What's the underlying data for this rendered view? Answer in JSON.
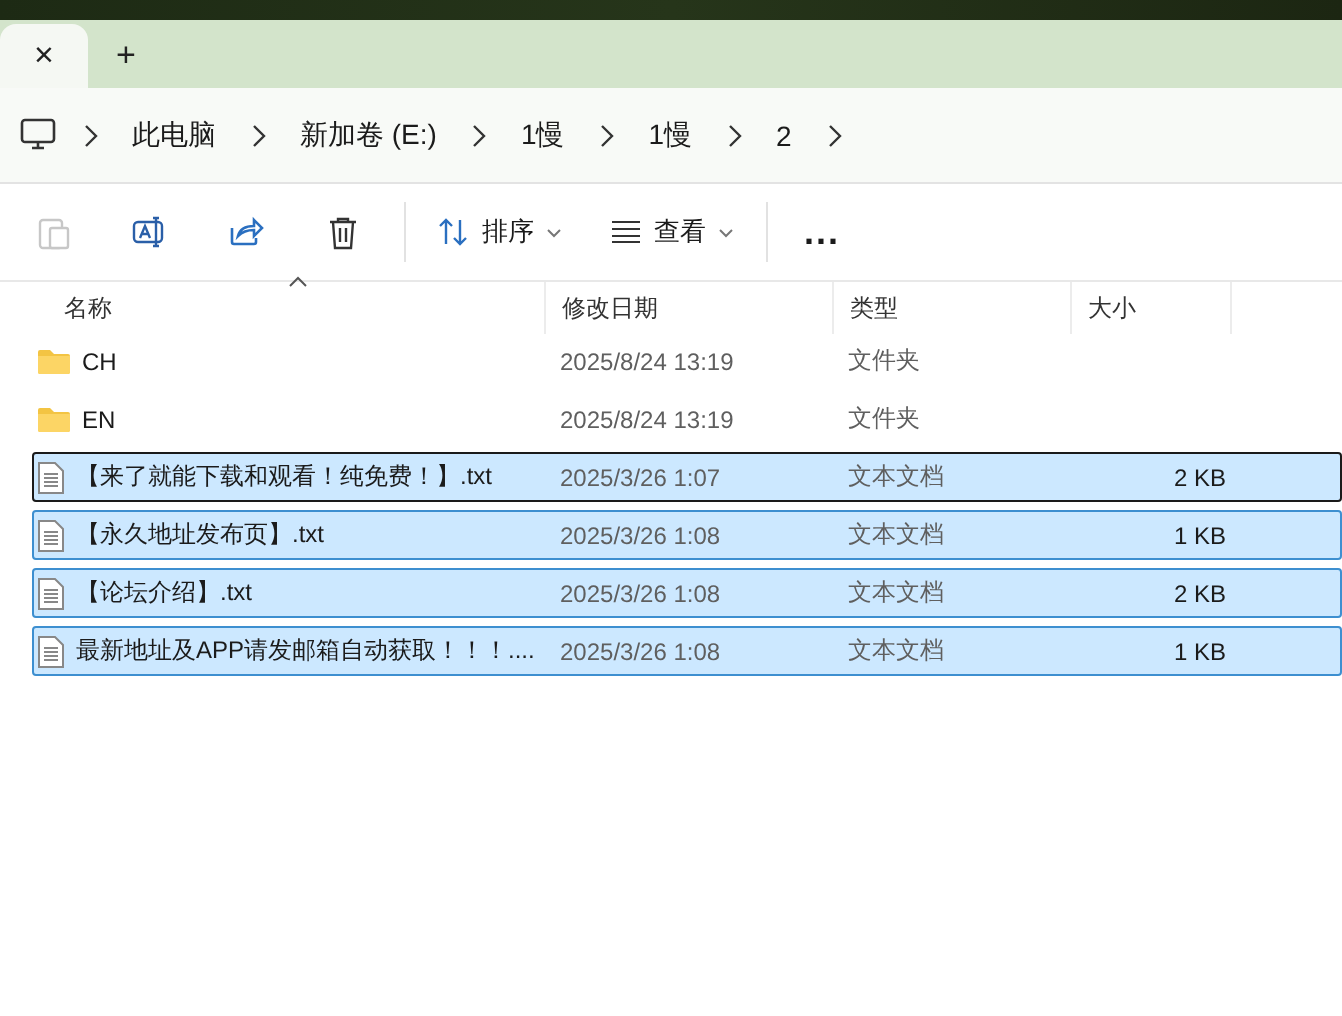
{
  "tab": {
    "close": "×",
    "add": "+"
  },
  "breadcrumb": [
    "此电脑",
    "新加卷 (E:)",
    "1慢",
    "1慢",
    "2"
  ],
  "toolbar": {
    "sort": "排序",
    "view": "查看",
    "more": "..."
  },
  "table": {
    "columns": [
      "名称",
      "修改日期",
      "类型",
      "大小"
    ],
    "rows": [
      {
        "kind": "folder",
        "name": "CH",
        "date": "2025/8/24 13:19",
        "type": "文件夹",
        "size": "",
        "selected": false,
        "focused": false
      },
      {
        "kind": "folder",
        "name": "EN",
        "date": "2025/8/24 13:19",
        "type": "文件夹",
        "size": "",
        "selected": false,
        "focused": false
      },
      {
        "kind": "file",
        "name": "【来了就能下载和观看！纯免费！】.txt",
        "date": "2025/3/26 1:07",
        "type": "文本文档",
        "size": "2 KB",
        "selected": true,
        "focused": true
      },
      {
        "kind": "file",
        "name": "【永久地址发布页】.txt",
        "date": "2025/3/26 1:08",
        "type": "文本文档",
        "size": "1 KB",
        "selected": true,
        "focused": false
      },
      {
        "kind": "file",
        "name": "【论坛介绍】.txt",
        "date": "2025/3/26 1:08",
        "type": "文本文档",
        "size": "2 KB",
        "selected": true,
        "focused": false
      },
      {
        "kind": "file",
        "name": "最新地址及APP请发邮箱自动获取！！！....",
        "date": "2025/3/26 1:08",
        "type": "文本文档",
        "size": "1 KB",
        "selected": true,
        "focused": false
      }
    ]
  }
}
